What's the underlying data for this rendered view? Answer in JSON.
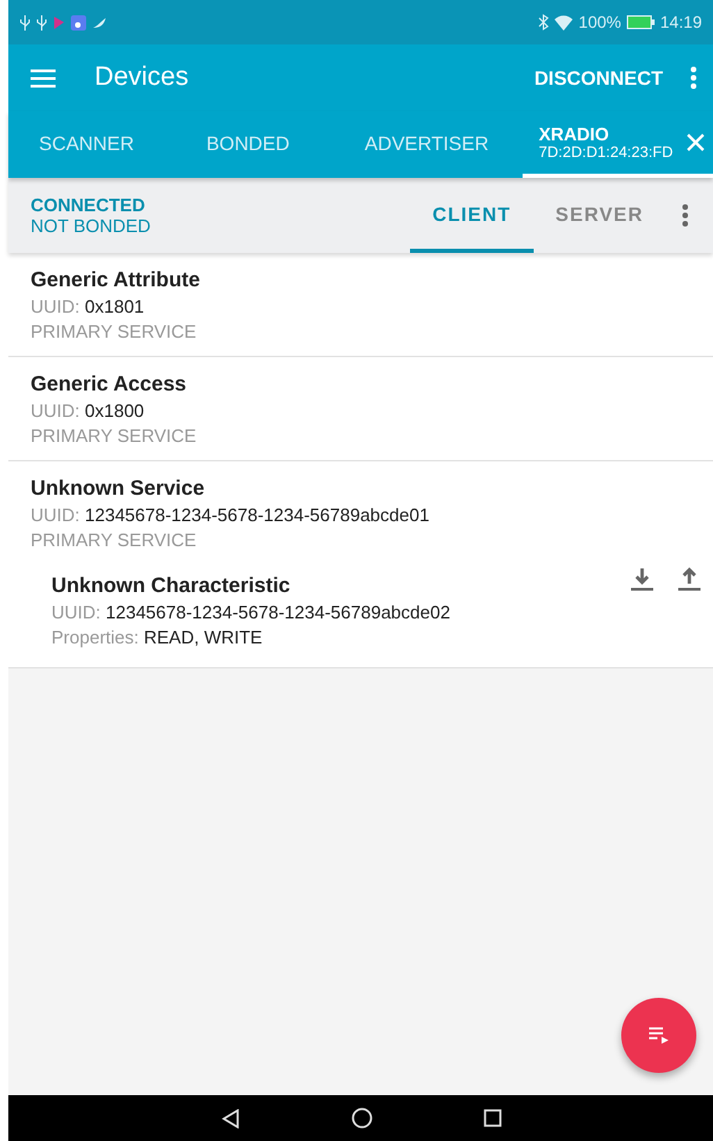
{
  "status_bar": {
    "battery": "100%",
    "time": "14:19"
  },
  "toolbar": {
    "title": "Devices",
    "action": "DISCONNECT"
  },
  "tabs": [
    {
      "label": "SCANNER",
      "selected": false
    },
    {
      "label": "BONDED",
      "selected": false
    },
    {
      "label": "ADVERTISER",
      "selected": false
    },
    {
      "label": "XRADIO",
      "address": "7D:2D:D1:24:23:FD",
      "selected": true
    }
  ],
  "connection": {
    "state": "CONNECTED",
    "bond": "NOT BONDED"
  },
  "mode_tabs": [
    {
      "label": "CLIENT",
      "selected": true
    },
    {
      "label": "SERVER",
      "selected": false
    }
  ],
  "services": [
    {
      "name": "Generic Attribute",
      "uuid_label": "UUID:",
      "uuid": "0x1801",
      "type": "PRIMARY SERVICE"
    },
    {
      "name": "Generic Access",
      "uuid_label": "UUID:",
      "uuid": "0x1800",
      "type": "PRIMARY SERVICE"
    },
    {
      "name": "Unknown Service",
      "uuid_label": "UUID:",
      "uuid": "12345678-1234-5678-1234-56789abcde01",
      "type": "PRIMARY SERVICE",
      "characteristics": [
        {
          "name": "Unknown Characteristic",
          "uuid_label": "UUID:",
          "uuid": "12345678-1234-5678-1234-56789abcde02",
          "properties_label": "Properties:",
          "properties": "READ, WRITE"
        }
      ]
    }
  ]
}
